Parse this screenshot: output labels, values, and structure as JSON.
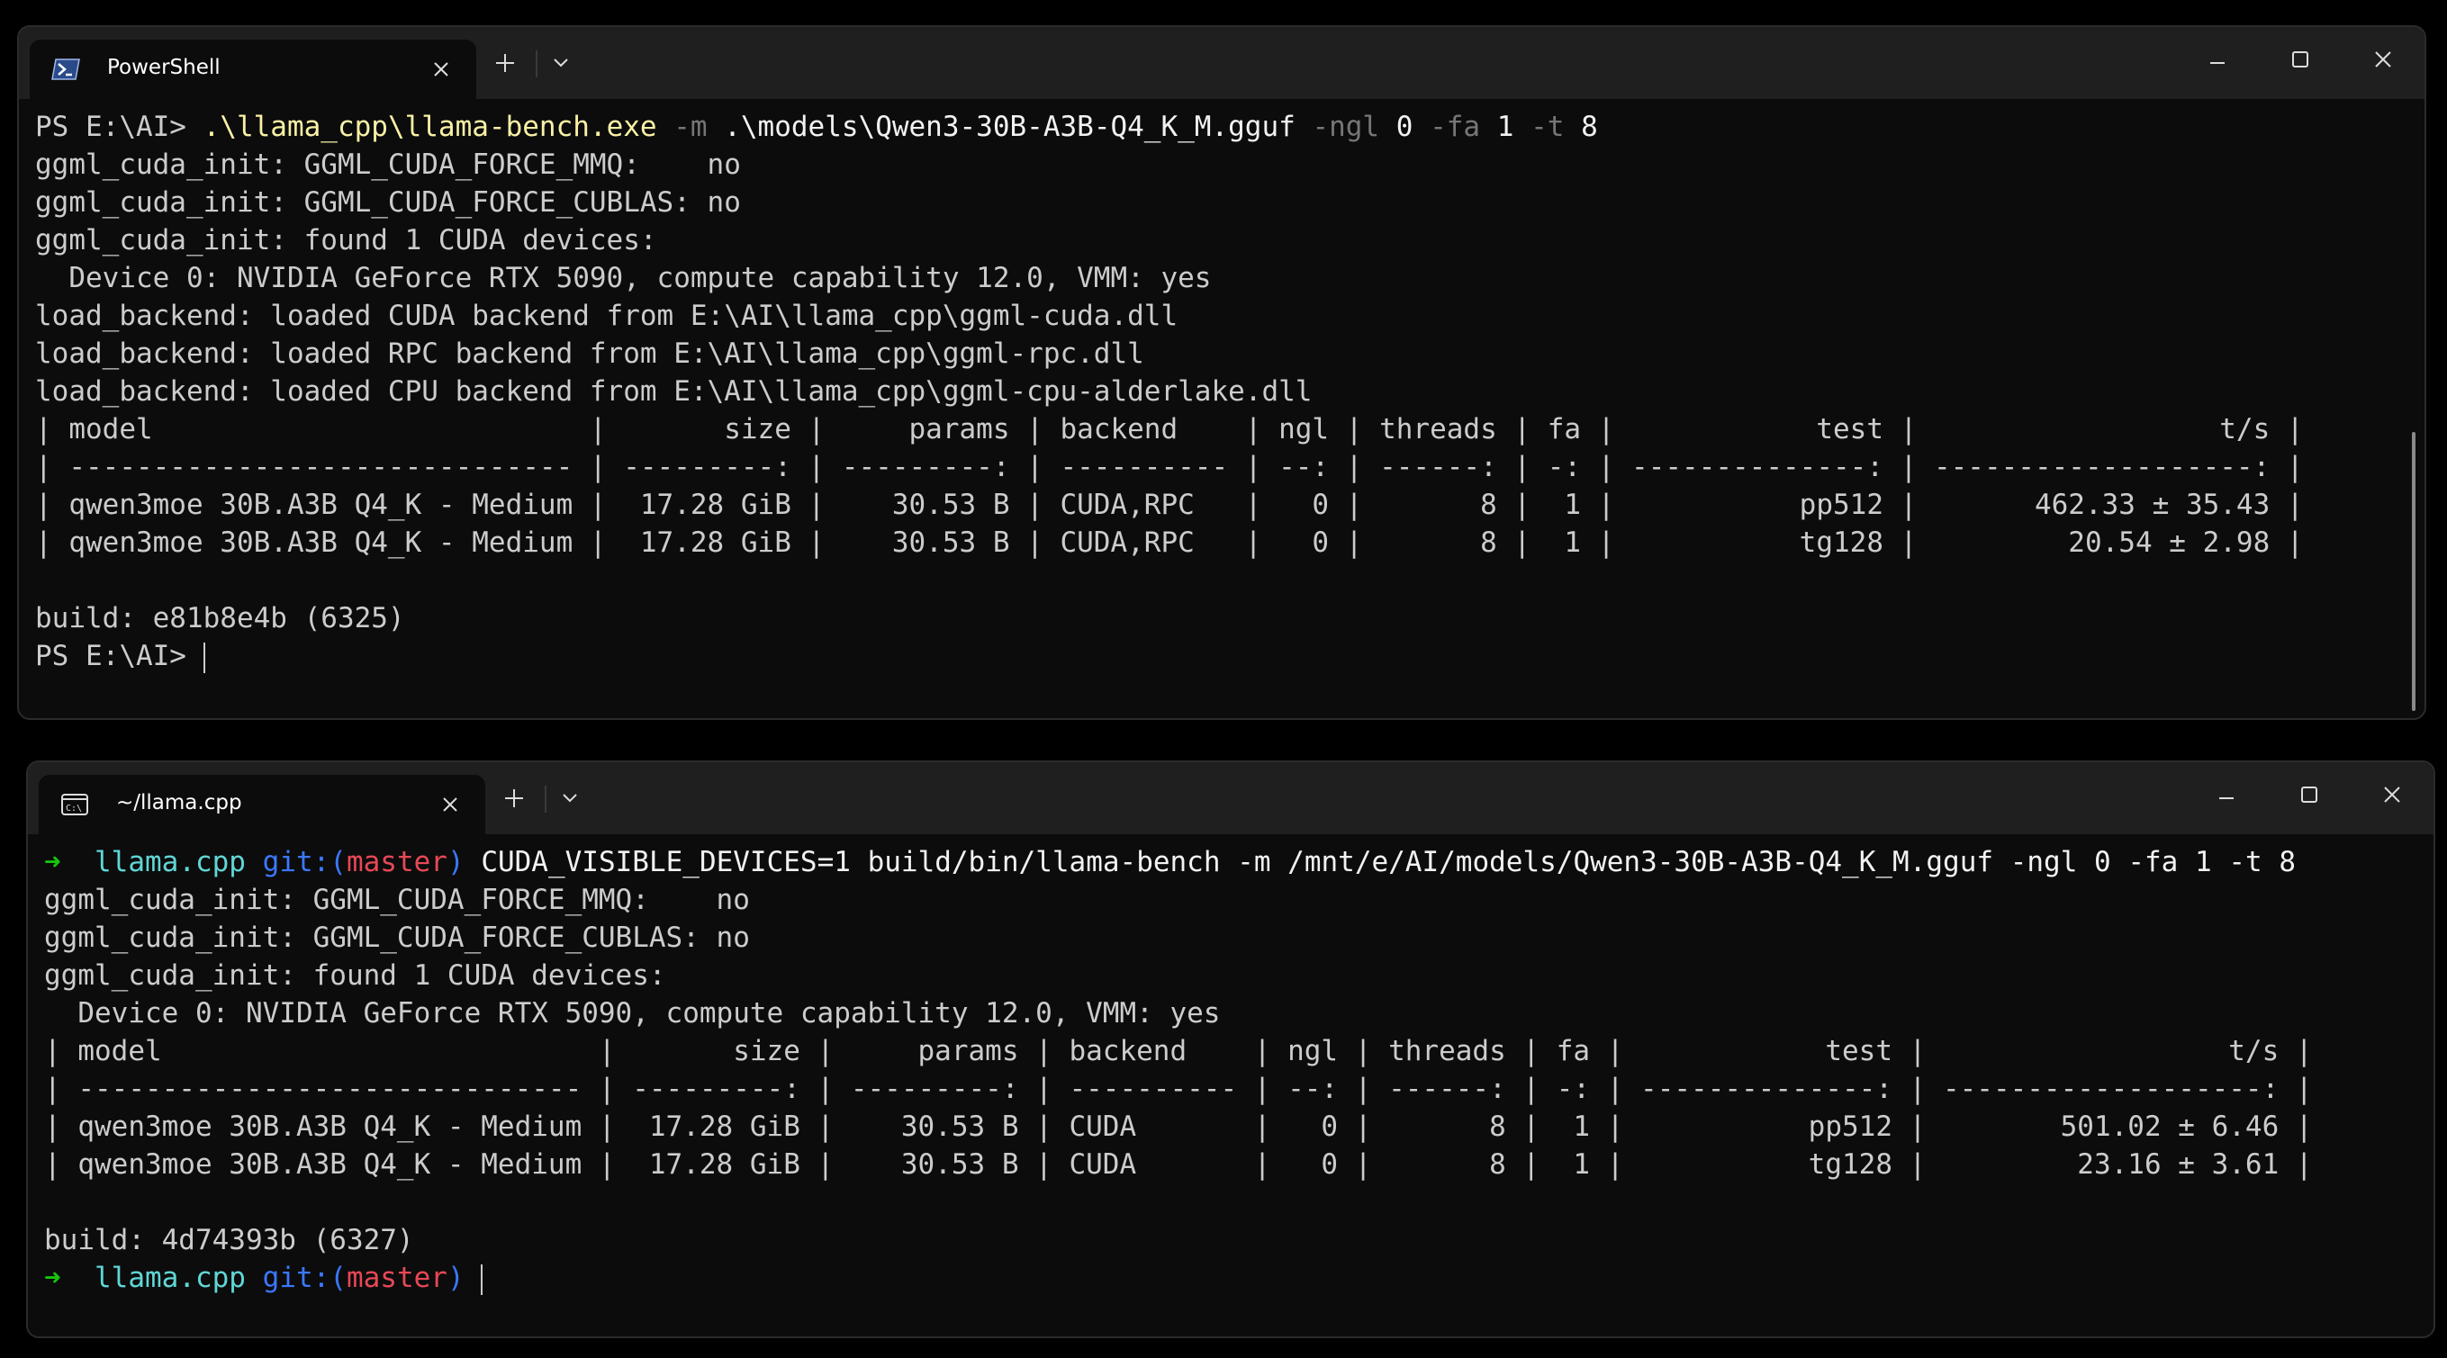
{
  "powershell_window": {
    "tab_title": "PowerShell",
    "prompt": "PS E:\\AI> ",
    "command_parts": {
      "exe": ".\\llama_cpp\\llama-bench.exe",
      "flag_m": " -m ",
      "model_path": ".\\models\\Qwen3-30B-A3B-Q4_K_M.gguf",
      "flag_ngl": " -ngl ",
      "ngl_val": "0",
      "flag_fa": " -fa ",
      "fa_val": "1",
      "flag_t": " -t ",
      "t_val": "8"
    },
    "output_lines": [
      "ggml_cuda_init: GGML_CUDA_FORCE_MMQ:    no",
      "ggml_cuda_init: GGML_CUDA_FORCE_CUBLAS: no",
      "ggml_cuda_init: found 1 CUDA devices:",
      "  Device 0: NVIDIA GeForce RTX 5090, compute capability 12.0, VMM: yes",
      "load_backend: loaded CUDA backend from E:\\AI\\llama_cpp\\ggml-cuda.dll",
      "load_backend: loaded RPC backend from E:\\AI\\llama_cpp\\ggml-rpc.dll",
      "load_backend: loaded CPU backend from E:\\AI\\llama_cpp\\ggml-cpu-alderlake.dll",
      "| model                          |       size |     params | backend    | ngl | threads | fa |            test |                  t/s |",
      "| ------------------------------ | ---------: | ---------: | ---------- | --: | ------: | -: | --------------: | -------------------: |",
      "| qwen3moe 30B.A3B Q4_K - Medium |  17.28 GiB |    30.53 B | CUDA,RPC   |   0 |       8 |  1 |           pp512 |       462.33 ± 35.43 |",
      "| qwen3moe 30B.A3B Q4_K - Medium |  17.28 GiB |    30.53 B | CUDA,RPC   |   0 |       8 |  1 |           tg128 |         20.54 ± 2.98 |",
      "",
      "build: e81b8e4b (6325)"
    ],
    "final_prompt": "PS E:\\AI> "
  },
  "linux_window": {
    "tab_title": "~/llama.cpp",
    "prompt": {
      "arrow": "➜",
      "dir": "llama.cpp",
      "git_label": "git:(",
      "branch": "master",
      "git_close": ")"
    },
    "command": "CUDA_VISIBLE_DEVICES=1 build/bin/llama-bench -m /mnt/e/AI/models/Qwen3-30B-A3B-Q4_K_M.gguf -ngl 0 -fa 1 -t 8",
    "output_lines": [
      "ggml_cuda_init: GGML_CUDA_FORCE_MMQ:    no",
      "ggml_cuda_init: GGML_CUDA_FORCE_CUBLAS: no",
      "ggml_cuda_init: found 1 CUDA devices:",
      "  Device 0: NVIDIA GeForce RTX 5090, compute capability 12.0, VMM: yes",
      "| model                          |       size |     params | backend    | ngl | threads | fa |            test |                  t/s |",
      "| ------------------------------ | ---------: | ---------: | ---------- | --: | ------: | -: | --------------: | -------------------: |",
      "| qwen3moe 30B.A3B Q4_K - Medium |  17.28 GiB |    30.53 B | CUDA       |   0 |       8 |  1 |           pp512 |        501.02 ± 6.46 |",
      "| qwen3moe 30B.A3B Q4_K - Medium |  17.28 GiB |    30.53 B | CUDA       |   0 |       8 |  1 |           tg128 |         23.16 ± 3.61 |",
      "",
      "build: 4d74393b (6327)"
    ]
  },
  "colors": {
    "terminal_bg": "#0c0c0c",
    "titlebar_bg": "#1f1f1f",
    "text": "#cccccc",
    "command_yellow": "#f9f1a5",
    "param_gray": "#767676",
    "arrow_green": "#16c60c",
    "dir_cyan": "#61d6d6",
    "git_blue": "#3b78ff",
    "branch_red": "#e74856"
  }
}
